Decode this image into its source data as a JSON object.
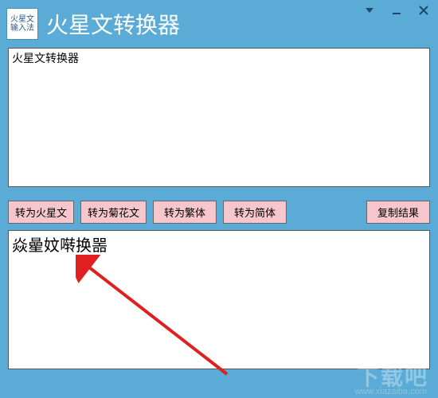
{
  "window": {
    "icon_line1": "火星文",
    "icon_line2": "输入法",
    "title": "火星文转换器"
  },
  "input": {
    "value": "火星文转换器"
  },
  "toolbar": {
    "to_martian": "转为火星文",
    "to_chrys": "转为菊花文",
    "to_trad": "转为繁体",
    "to_simp": "转为简体",
    "copy_result": "复制结果"
  },
  "output": {
    "value": "焱曐妏啭换噐"
  },
  "watermark": {
    "main": "下载吧",
    "sub": "www.xiazaiba.com"
  }
}
